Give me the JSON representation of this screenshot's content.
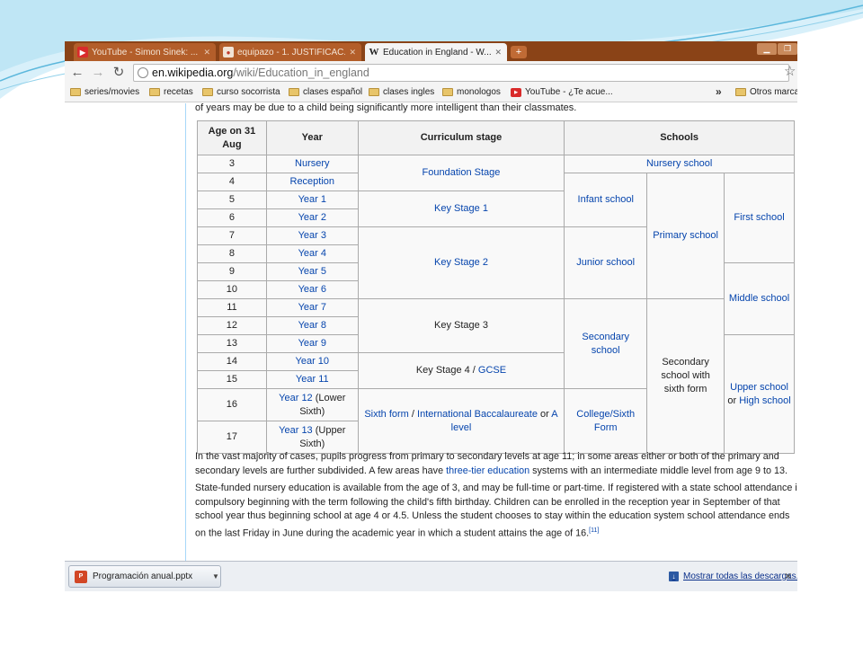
{
  "browser": {
    "tabs": [
      {
        "icon": "youtube-icon",
        "title": "YouTube - Simon Sinek: ...",
        "active": false
      },
      {
        "icon": "apple-icon",
        "title": "equipazo - 1. JUSTIFICAC...",
        "active": false
      },
      {
        "icon": "wikipedia-icon",
        "title": "Education in England - W...",
        "active": true
      }
    ],
    "address": {
      "host": "en.wikipedia.org",
      "path": "/wiki/Education_in_england"
    },
    "bookmarks": [
      {
        "type": "folder",
        "label": "series/movies"
      },
      {
        "type": "folder",
        "label": "recetas"
      },
      {
        "type": "folder",
        "label": "curso socorrista"
      },
      {
        "type": "folder",
        "label": "clases español"
      },
      {
        "type": "folder",
        "label": "clases ingles"
      },
      {
        "type": "folder",
        "label": "monologos"
      },
      {
        "type": "youtube",
        "label": "YouTube - ¿Te acue..."
      }
    ],
    "bookmarks_overflow": "»",
    "other_bookmarks": "Otros marca"
  },
  "page": {
    "intro_line": "of years may be due to a child being significantly more intelligent than their classmates.",
    "table": {
      "headers": [
        "Age on 31 Aug",
        "Year",
        "Curriculum stage",
        "Schools"
      ],
      "ages": [
        "3",
        "4",
        "5",
        "6",
        "7",
        "8",
        "9",
        "10",
        "11",
        "12",
        "13",
        "14",
        "15",
        "16",
        "17"
      ],
      "years": [
        "Nursery",
        "Reception",
        "Year 1",
        "Year 2",
        "Year 3",
        "Year 4",
        "Year 5",
        "Year 6",
        "Year 7",
        "Year 8",
        "Year 9",
        "Year 10",
        "Year 11"
      ],
      "year12": {
        "link": "Year 12",
        "text": " (Lower Sixth)"
      },
      "year13": {
        "link": "Year 13",
        "text": " (Upper Sixth)"
      },
      "stages": {
        "foundation": "Foundation Stage",
        "ks1": "Key Stage 1",
        "ks2": "Key Stage 2",
        "ks3": "Key Stage 3",
        "ks4_text": "Key Stage 4",
        "ks4_sep": " / ",
        "ks4_link": "GCSE",
        "sixth_form": "Sixth form",
        "sep1": " / ",
        "ib": "International Baccalaureate",
        "or": " or ",
        "alevel": "A level"
      },
      "schools": {
        "nursery": "Nursery school",
        "infant": "Infant school",
        "junior": "Junior school",
        "primary": "Primary school",
        "first": "First school",
        "middle": "Middle school",
        "secondary": "Secondary school",
        "secondary_sixth": "Secondary school with sixth form",
        "college": "College/Sixth Form",
        "upper": "Upper school",
        "or": " or ",
        "high": "High school"
      }
    },
    "para1_line1": "In the vast majority of cases, pupils progress from primary to secondary levels at age 11; in some areas either or both of the primary and",
    "para1_line2_a": "secondary levels are further subdivided. A few areas have ",
    "para1_line2_link": "three-tier education",
    "para1_line2_b": " systems with an intermediate middle level from age 9 to 13.",
    "para2_lines": [
      "State-funded nursery education is available from the age of 3, and may be full-time or part-time. If registered with a state school attendance i",
      "compulsory beginning with the term following the child's fifth birthday. Children can be enrolled in the reception year in September of that",
      "school year thus beginning school at age 4 or 4.5. Unless the student chooses to stay within the education system school attendance ends",
      "on the last Friday in June during the academic year in which a student attains the age of 16."
    ],
    "citation": "[11]"
  },
  "downloads": {
    "file": "Programación anual.pptx",
    "show_all": "Mostrar todas las descargas..."
  },
  "colors": {
    "tabstrip": "#8a4317",
    "link": "#0645ad",
    "swoosh_light": "#bfe6f5",
    "swoosh_dark": "#3aa0c8"
  }
}
